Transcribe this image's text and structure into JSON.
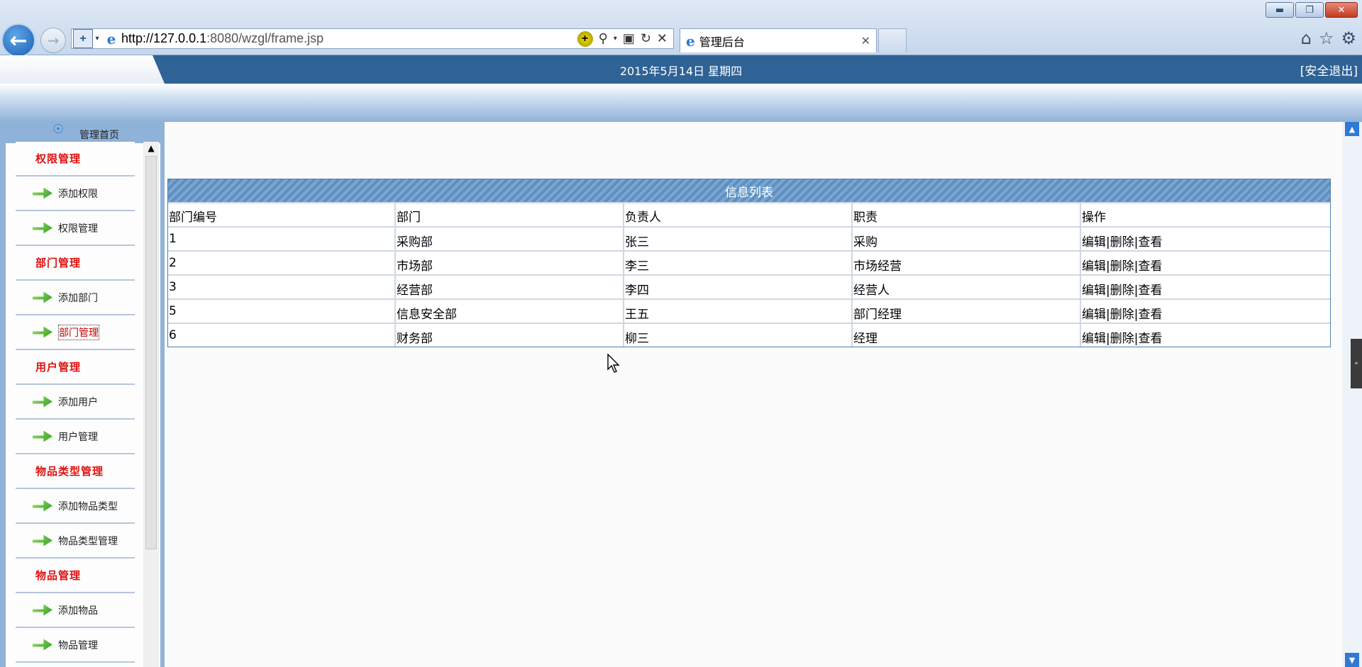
{
  "browser": {
    "url_host": "http://127.0.0.1",
    "url_rest": ":8080/wzgl/frame.jsp",
    "tab_title": "管理后台",
    "window_controls": {
      "minimize_icon": "minimize-icon",
      "restore_icon": "restore-icon",
      "close_icon": "close-icon"
    }
  },
  "header": {
    "date": "2015年5月14日  星期四",
    "logout": "[安全退出]"
  },
  "sidebar": {
    "home_label": "管理首页",
    "groups": [
      {
        "title": "权限管理",
        "items": [
          "添加权限",
          "权限管理"
        ]
      },
      {
        "title": "部门管理",
        "items": [
          "添加部门",
          "部门管理"
        ]
      },
      {
        "title": "用户管理",
        "items": [
          "添加用户",
          "用户管理"
        ]
      },
      {
        "title": "物品类型管理",
        "items": [
          "添加物品类型",
          "物品类型管理"
        ]
      },
      {
        "title": "物品管理",
        "items": [
          "添加物品",
          "物品管理"
        ]
      }
    ],
    "active_item": "部门管理"
  },
  "table": {
    "caption": "信息列表",
    "columns": [
      "部门编号",
      "部门",
      "负责人",
      "职责",
      "操作"
    ],
    "rows": [
      [
        "1",
        "采购部",
        "张三",
        "采购"
      ],
      [
        "2",
        "市场部",
        "李三",
        "市场经营"
      ],
      [
        "3",
        "经营部",
        "李四",
        "经营人"
      ],
      [
        "5",
        "信息安全部",
        "王五",
        "部门经理"
      ],
      [
        "6",
        "财务部",
        "柳三",
        "经理"
      ]
    ],
    "actions": {
      "edit": "编辑",
      "delete": "删除",
      "view": "查看",
      "sep": "|"
    }
  }
}
